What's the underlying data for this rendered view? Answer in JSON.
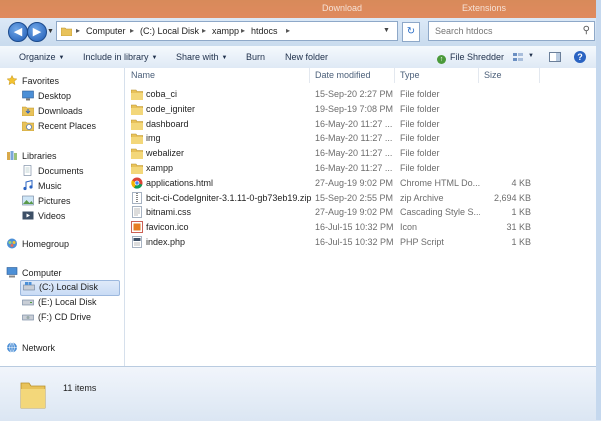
{
  "background_ghost": [
    "Download",
    "Extensions"
  ],
  "address": {
    "crumbs": [
      "Computer",
      "(C:) Local Disk",
      "xampp",
      "htdocs"
    ]
  },
  "search": {
    "placeholder": "Search htdocs"
  },
  "toolbar": {
    "organize": "Organize",
    "include_in_library": "Include in library",
    "share_with": "Share with",
    "burn": "Burn",
    "new_folder": "New folder",
    "file_shredder": "File Shredder"
  },
  "nav": {
    "favorites": "Favorites",
    "favorites_items": [
      "Desktop",
      "Downloads",
      "Recent Places"
    ],
    "libraries": "Libraries",
    "libraries_items": [
      "Documents",
      "Music",
      "Pictures",
      "Videos"
    ],
    "homegroup": "Homegroup",
    "computer": "Computer",
    "computer_items": [
      "(C:) Local Disk",
      "(E:) Local Disk",
      "(F:) CD Drive"
    ],
    "network": "Network"
  },
  "columns": {
    "name": "Name",
    "date": "Date modified",
    "type": "Type",
    "size": "Size"
  },
  "files": [
    {
      "name": "coba_ci",
      "date": "15-Sep-20 2:27 PM",
      "type": "File folder",
      "size": "",
      "icon": "folder-icon"
    },
    {
      "name": "code_igniter",
      "date": "19-Sep-19 7:08 PM",
      "type": "File folder",
      "size": "",
      "icon": "folder-icon"
    },
    {
      "name": "dashboard",
      "date": "16-May-20 11:27 ...",
      "type": "File folder",
      "size": "",
      "icon": "folder-icon"
    },
    {
      "name": "img",
      "date": "16-May-20 11:27 ...",
      "type": "File folder",
      "size": "",
      "icon": "folder-icon"
    },
    {
      "name": "webalizer",
      "date": "16-May-20 11:27 ...",
      "type": "File folder",
      "size": "",
      "icon": "folder-icon"
    },
    {
      "name": "xampp",
      "date": "16-May-20 11:27 ...",
      "type": "File folder",
      "size": "",
      "icon": "folder-icon"
    },
    {
      "name": "applications.html",
      "date": "27-Aug-19 9:02 PM",
      "type": "Chrome HTML Do...",
      "size": "4 KB",
      "icon": "chrome-html-icon"
    },
    {
      "name": "bcit-ci-CodeIgniter-3.1.11-0-gb73eb19.zip",
      "date": "15-Sep-20 2:55 PM",
      "type": "zip Archive",
      "size": "2,694 KB",
      "icon": "zip-icon"
    },
    {
      "name": "bitnami.css",
      "date": "27-Aug-19 9:02 PM",
      "type": "Cascading Style S...",
      "size": "1 KB",
      "icon": "css-file-icon"
    },
    {
      "name": "favicon.ico",
      "date": "16-Jul-15 10:32 PM",
      "type": "Icon",
      "size": "31 KB",
      "icon": "ico-file-icon"
    },
    {
      "name": "index.php",
      "date": "16-Jul-15 10:32 PM",
      "type": "PHP Script",
      "size": "1 KB",
      "icon": "php-file-icon"
    }
  ],
  "details": {
    "item_count": "11 items"
  }
}
